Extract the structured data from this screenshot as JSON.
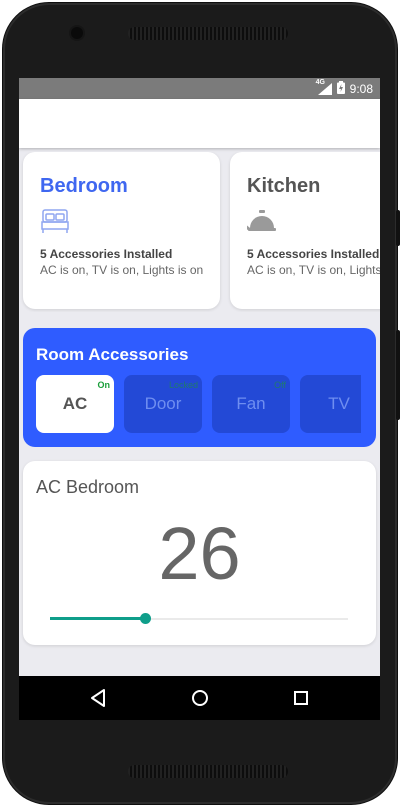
{
  "status_bar": {
    "network": "4G",
    "time": "9:08"
  },
  "rooms": [
    {
      "name": "Bedroom",
      "icon": "bed-icon",
      "accessories": "5 Accessories Installed",
      "status": "AC is on, TV is on, Lights is on",
      "selected": true
    },
    {
      "name": "Kitchen",
      "icon": "cloche-icon",
      "accessories": "5 Accessories Installed",
      "status": "AC is on, TV is on, Lights is on",
      "selected": false
    }
  ],
  "accessories_panel": {
    "title": "Room Accessories",
    "items": [
      {
        "label": "AC",
        "badge": "On",
        "selected": true
      },
      {
        "label": "Door",
        "badge": "Locked",
        "selected": false
      },
      {
        "label": "Fan",
        "badge": "Off",
        "selected": false
      },
      {
        "label": "TV",
        "badge": "",
        "selected": false
      }
    ]
  },
  "detail": {
    "title": "AC Bedroom",
    "value": "26",
    "slider_level": 0.32
  },
  "colors": {
    "accent_blue": "#2f5cff",
    "room_title_selected": "#3f67f0",
    "room_title": "#555555",
    "slider": "#0f9e8a"
  },
  "navigation": {
    "back": "back-icon",
    "home": "home-icon",
    "recents": "recents-icon"
  }
}
